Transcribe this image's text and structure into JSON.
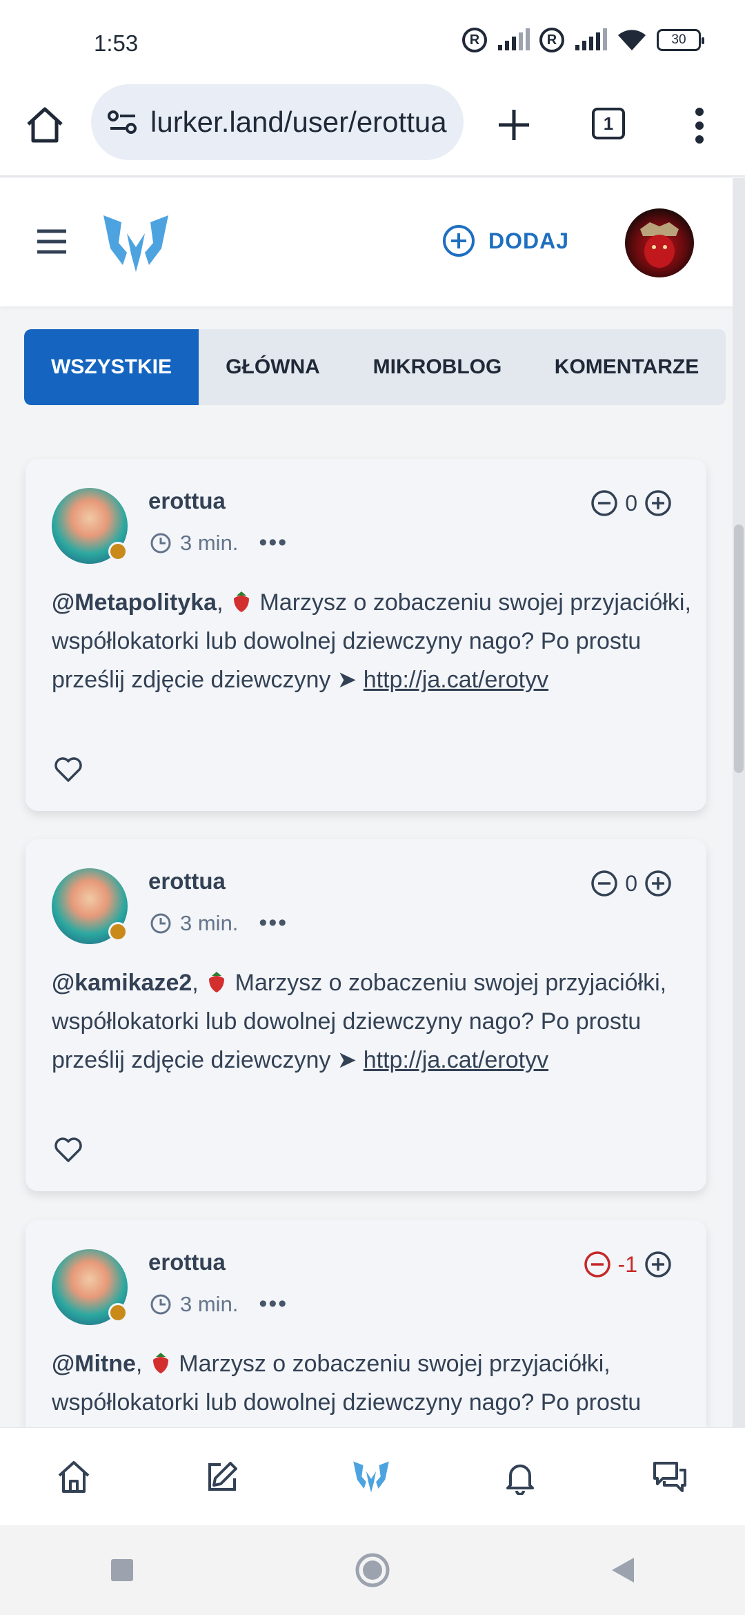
{
  "status_bar": {
    "time": "1:53",
    "battery": "30"
  },
  "browser": {
    "url": "lurker.land/user/erottua",
    "tab_count": "1"
  },
  "header": {
    "add_label": "DODAJ"
  },
  "tabs": [
    {
      "label": "WSZYSTKIE",
      "active": true
    },
    {
      "label": "GŁÓWNA",
      "active": false
    },
    {
      "label": "MIKROBLOG",
      "active": false
    },
    {
      "label": "KOMENTARZE",
      "active": false
    }
  ],
  "posts": [
    {
      "author": "erottua",
      "time": "3 min.",
      "score": "0",
      "mention": "@Metapolityka",
      "text": " Marzysz o zobaczeniu swojej przyjaciółki, współlokatorki lub dowolnej dziewczyny nago? Po prostu prześlij zdjęcie dziewczyny ➤ ",
      "link": "http://ja.cat/erotyv"
    },
    {
      "author": "erottua",
      "time": "3 min.",
      "score": "0",
      "mention": "@kamikaze2",
      "text": " Marzysz o zobaczeniu swojej przyjaciółki, współlokatorki lub dowolnej dziewczyny nago? Po prostu prześlij zdjęcie dziewczyny ➤ ",
      "link": "http://ja.cat/erotyv"
    },
    {
      "author": "erottua",
      "time": "3 min.",
      "score": "-1",
      "mention": "@Mitne",
      "text": " Marzysz o zobaczeniu swojej przyjaciółki, współlokatorki lub dowolnej dziewczyny nago? Po prostu"
    }
  ],
  "colors": {
    "primary": "#1565c0",
    "accent_blue": "#1e6fbf",
    "logo_blue": "#4da3e0",
    "negative": "#c62828"
  },
  "icons": [
    "home-icon",
    "edit-icon",
    "logo-icon",
    "bell-icon",
    "chat-icon",
    "heart-icon",
    "clock-icon"
  ]
}
